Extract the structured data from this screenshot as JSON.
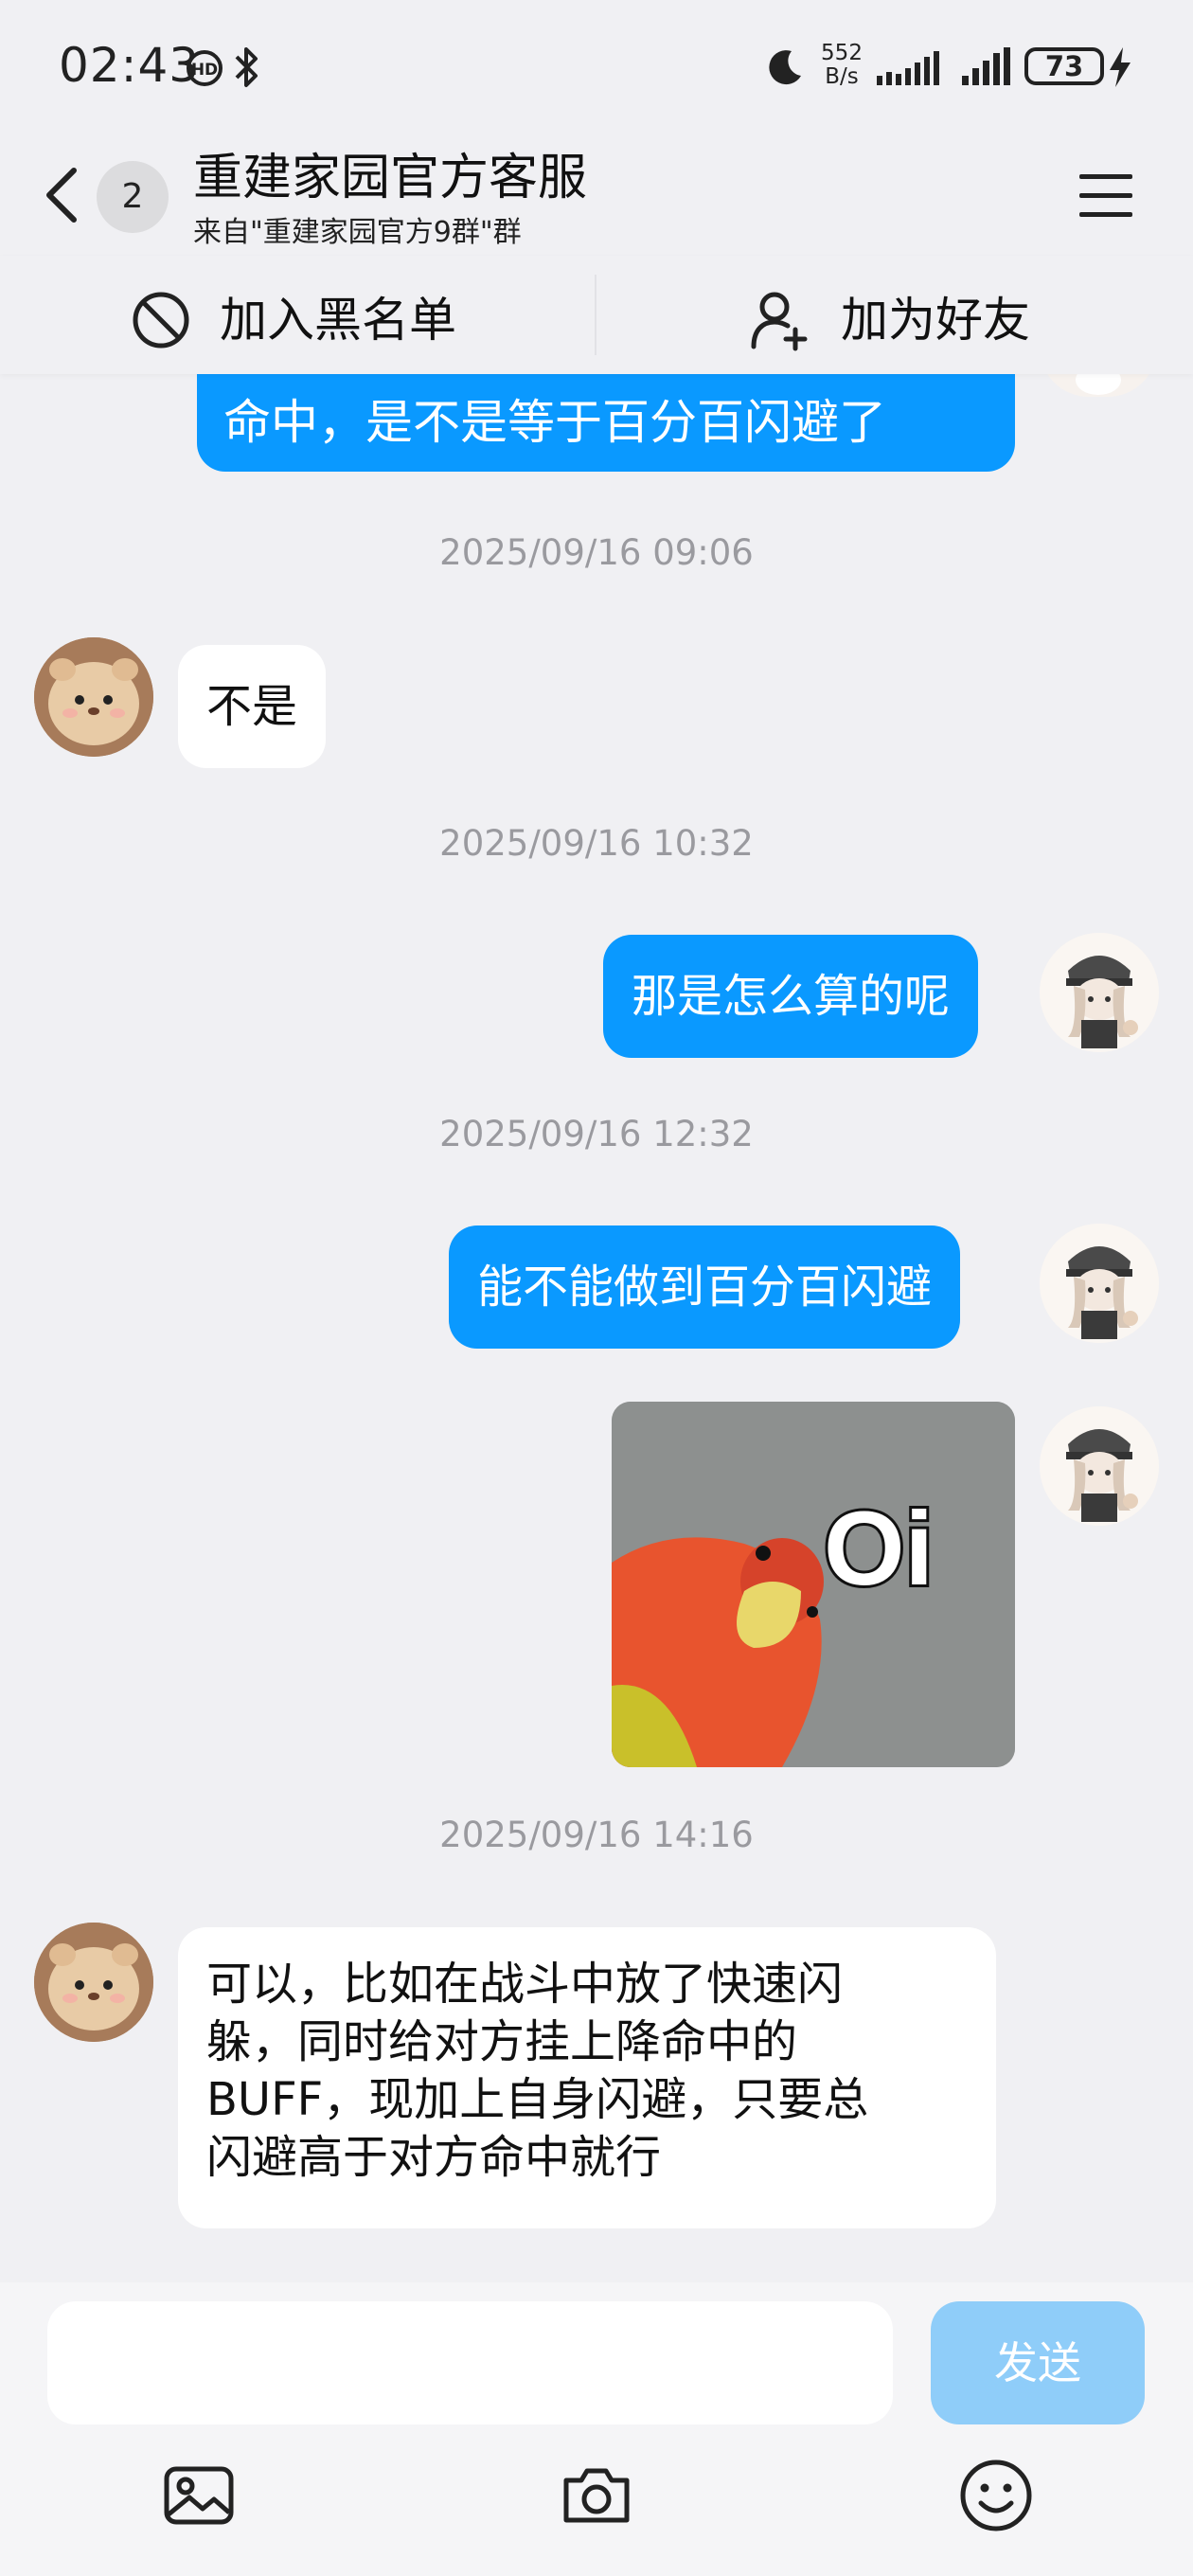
{
  "status_bar": {
    "time": "02:43",
    "net_speed_value": "552",
    "net_speed_unit": "B/s",
    "battery": "73",
    "icons": [
      "hd-call-icon",
      "bluetooth-icon",
      "moon-icon",
      "signal-icon",
      "signal-icon",
      "battery-icon",
      "charging-icon"
    ]
  },
  "header": {
    "back_icon": "back-chevron-icon",
    "unread_count": "2",
    "title": "重建家园官方客服",
    "subtitle": "来自\"重建家园官方9群\"群",
    "menu_icon": "hamburger-menu-icon"
  },
  "actions": {
    "block_label": "加入黑名单",
    "add_friend_label": "加为好友"
  },
  "messages": {
    "cut_off_text": "命中，是不是等于百分百闪避了",
    "ts1": "2025/09/16 09:06",
    "m1": "不是",
    "ts2": "2025/09/16 10:32",
    "m2": "那是怎么算的呢",
    "ts3": "2025/09/16 12:32",
    "m3": "能不能做到百分百闪避",
    "sticker_text": "Oi",
    "ts4": "2025/09/16 14:16",
    "m4_l1": "可以，比如在战斗中放了快速闪",
    "m4_l2": "躲，同时给对方挂上降命中的",
    "m4_l3": "BUFF，现加上自身闪避，只要总",
    "m4_l4": "闪避高于对方命中就行"
  },
  "composer": {
    "input_value": "",
    "send_label": "发送",
    "icons": [
      "image-icon",
      "camera-icon",
      "emoji-icon"
    ]
  },
  "colors": {
    "accent": "#0a99ff",
    "send_button_disabled": "#8fcdf9",
    "background": "#f0f0f3"
  }
}
